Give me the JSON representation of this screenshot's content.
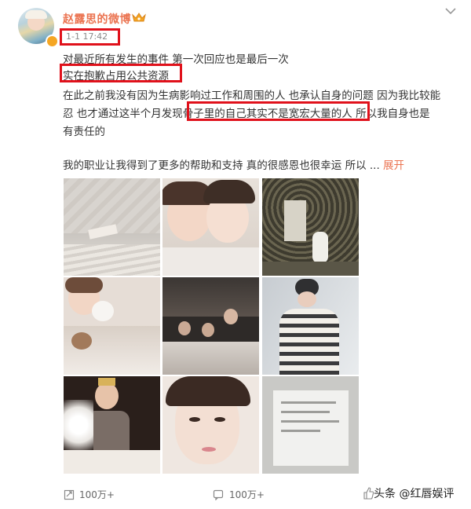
{
  "post": {
    "author": "赵露思的微博",
    "time": "1-1 17:42",
    "lines": [
      "对最近所有发生的事件 第一次回应也是最后一次",
      "实在抱歉占用公共资源",
      "在此之前我没有因为生病影响过工作和周围的人 也承认自身的问题 因为我比较能",
      "忍 也才通过这半个月发现骨子里的自己其实不是宽宏大量的人 所以我自身也是",
      "有责任的",
      "我的职业让我得到了更多的帮助和支持 真的很感恩也很幸运 所以 ..."
    ],
    "expand_label": "展开",
    "photos": [
      "photo-1",
      "photo-2",
      "photo-3",
      "photo-4",
      "photo-5",
      "photo-6",
      "photo-7",
      "photo-8",
      "photo-9"
    ]
  },
  "actions": {
    "repost_count": "100万+",
    "comment_count": "100万+"
  },
  "watermark": "头条 @红唇娱评",
  "colors": {
    "accent": "#eb7350",
    "highlight_box": "#e0111b"
  },
  "icons": {
    "verify": "verified-badge-icon",
    "crown": "vip-crown-icon",
    "menu": "chevron-down-icon",
    "repost": "repost-icon",
    "comment": "comment-icon",
    "like": "like-icon"
  }
}
